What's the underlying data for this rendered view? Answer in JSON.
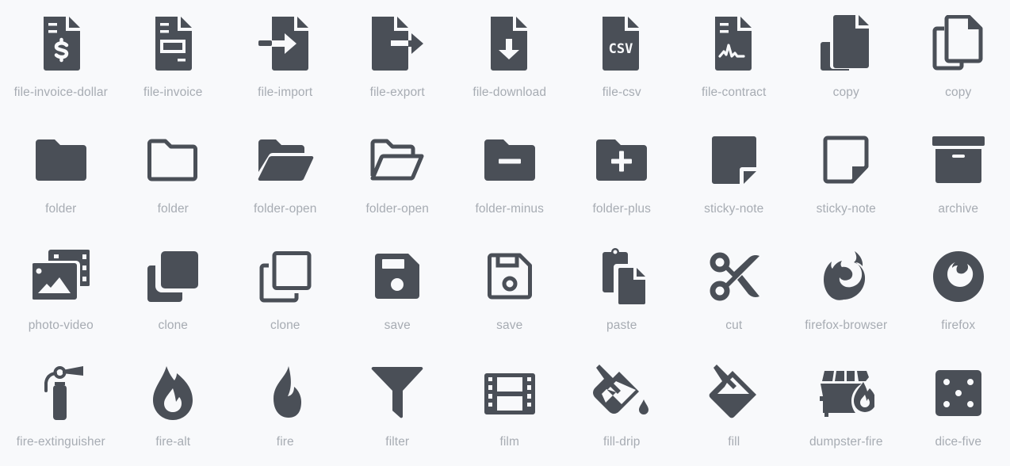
{
  "colors": {
    "icon": "#4a4f57",
    "label": "#a7acb3",
    "background": "#f8f9fb"
  },
  "icons": [
    {
      "name": "file-invoice-dollar",
      "icon": "file-invoice-dollar-icon"
    },
    {
      "name": "file-invoice",
      "icon": "file-invoice-icon"
    },
    {
      "name": "file-import",
      "icon": "file-import-icon"
    },
    {
      "name": "file-export",
      "icon": "file-export-icon"
    },
    {
      "name": "file-download",
      "icon": "file-download-icon"
    },
    {
      "name": "file-csv",
      "icon": "file-csv-icon",
      "glyph_text": "CSV"
    },
    {
      "name": "file-contract",
      "icon": "file-contract-icon"
    },
    {
      "name": "copy",
      "icon": "copy-solid-icon"
    },
    {
      "name": "copy",
      "icon": "copy-outline-icon"
    },
    {
      "name": "folder",
      "icon": "folder-solid-icon"
    },
    {
      "name": "folder",
      "icon": "folder-outline-icon"
    },
    {
      "name": "folder-open",
      "icon": "folder-open-solid-icon"
    },
    {
      "name": "folder-open",
      "icon": "folder-open-outline-icon"
    },
    {
      "name": "folder-minus",
      "icon": "folder-minus-icon"
    },
    {
      "name": "folder-plus",
      "icon": "folder-plus-icon"
    },
    {
      "name": "sticky-note",
      "icon": "sticky-note-solid-icon"
    },
    {
      "name": "sticky-note",
      "icon": "sticky-note-outline-icon"
    },
    {
      "name": "archive",
      "icon": "archive-icon"
    },
    {
      "name": "photo-video",
      "icon": "photo-video-icon"
    },
    {
      "name": "clone",
      "icon": "clone-solid-icon"
    },
    {
      "name": "clone",
      "icon": "clone-outline-icon"
    },
    {
      "name": "save",
      "icon": "save-solid-icon"
    },
    {
      "name": "save",
      "icon": "save-outline-icon"
    },
    {
      "name": "paste",
      "icon": "paste-icon"
    },
    {
      "name": "cut",
      "icon": "cut-icon"
    },
    {
      "name": "firefox-browser",
      "icon": "firefox-browser-icon"
    },
    {
      "name": "firefox",
      "icon": "firefox-icon"
    },
    {
      "name": "fire-extinguisher",
      "icon": "fire-extinguisher-icon"
    },
    {
      "name": "fire-alt",
      "icon": "fire-alt-icon"
    },
    {
      "name": "fire",
      "icon": "fire-icon"
    },
    {
      "name": "filter",
      "icon": "filter-icon"
    },
    {
      "name": "film",
      "icon": "film-icon"
    },
    {
      "name": "fill-drip",
      "icon": "fill-drip-icon"
    },
    {
      "name": "fill",
      "icon": "fill-icon"
    },
    {
      "name": "dumpster-fire",
      "icon": "dumpster-fire-icon"
    },
    {
      "name": "dice-five",
      "icon": "dice-five-icon"
    }
  ]
}
